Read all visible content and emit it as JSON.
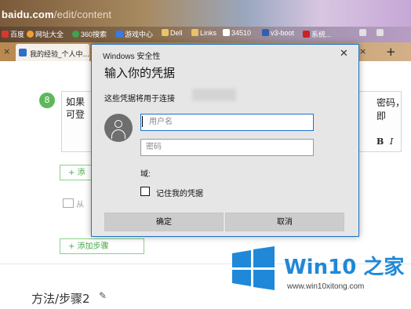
{
  "browser": {
    "address": {
      "host": "baidu.com",
      "path": "/edit/content"
    },
    "bookmarks": [
      {
        "label": "百度",
        "color": "#d8382e"
      },
      {
        "label": "网址大全",
        "color": "#f0a030"
      },
      {
        "label": "360搜索",
        "color": "#3ca44c"
      },
      {
        "label": "游戏中心",
        "color": "#3a7be0"
      },
      {
        "label": "Dell",
        "color": "#e7c36a"
      },
      {
        "label": "Links",
        "color": "#e7c36a"
      },
      {
        "label": "34510",
        "color": "#ffffff"
      },
      {
        "label": "v3-boot",
        "color": "#2f5fb5"
      },
      {
        "label": "系统...",
        "color": "#cc2222"
      }
    ],
    "tabs": [
      {
        "label": "我的经验_个人中..."
      }
    ],
    "tab_close_glyph": "×",
    "tab_plus_glyph": "+"
  },
  "page": {
    "step_number": "8",
    "step_text_left_1": "如果",
    "step_text_left_2": "可登",
    "step_text_right": "密码，即",
    "format_bold": "B",
    "format_italic": "I",
    "add_button_1": "+ 添",
    "image_label": "从",
    "add_button_2": "+ 添加步骤",
    "method_heading": "方法/步骤2",
    "pencil_icon": "✎"
  },
  "dialog": {
    "window_title": "Windows 安全性",
    "close_glyph": "✕",
    "heading": "输入你的凭据",
    "subtitle": "这些凭据将用于连接",
    "username_placeholder": "用户名",
    "password_placeholder": "密码",
    "domain_label": "域:",
    "remember_label": "记住我的凭据",
    "ok_label": "确定",
    "cancel_label": "取消",
    "accent_color": "#1c73c9"
  },
  "watermark": {
    "brand": "Win10 之家",
    "url": "www.win10xitong.com"
  }
}
